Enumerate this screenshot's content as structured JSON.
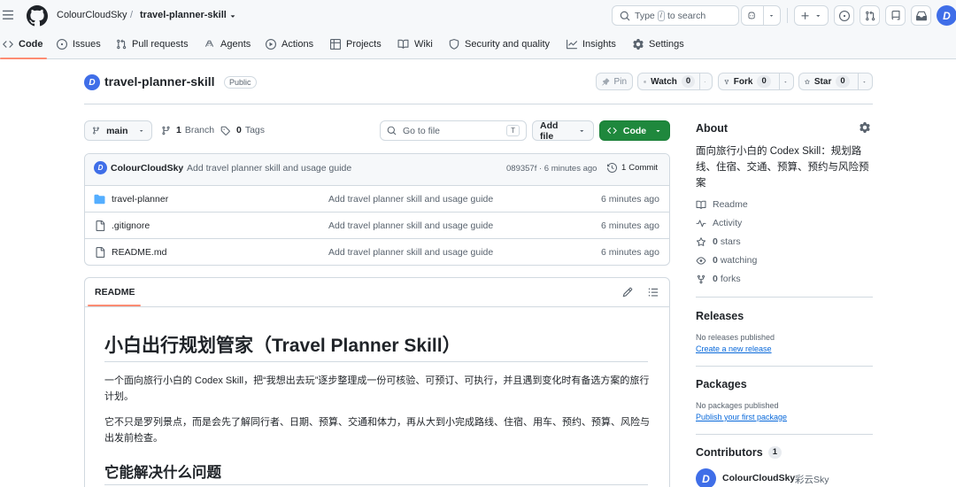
{
  "header": {
    "owner": "ColourCloudSky",
    "slash": "/",
    "repo": "travel-planner-skill",
    "search_prefix": "Type",
    "search_key": "/",
    "search_suffix": "to search",
    "avatar_letter": "D"
  },
  "tabs": [
    {
      "label": "Code",
      "icon": "code-icon"
    },
    {
      "label": "Issues",
      "icon": "issue-icon"
    },
    {
      "label": "Pull requests",
      "icon": "pull-request-icon"
    },
    {
      "label": "Agents",
      "icon": "agent-icon"
    },
    {
      "label": "Actions",
      "icon": "play-icon"
    },
    {
      "label": "Projects",
      "icon": "table-icon"
    },
    {
      "label": "Wiki",
      "icon": "book-icon"
    },
    {
      "label": "Security and quality",
      "icon": "shield-icon"
    },
    {
      "label": "Insights",
      "icon": "graph-icon"
    },
    {
      "label": "Settings",
      "icon": "gear-icon"
    }
  ],
  "repo_header": {
    "avatar_letter": "D",
    "name": "travel-planner-skill",
    "visibility": "Public",
    "pin_label": "Pin",
    "watch_label": "Watch",
    "watch_count": "0",
    "fork_label": "Fork",
    "fork_count": "0",
    "star_label": "Star",
    "star_count": "0"
  },
  "toolbar": {
    "branch": "main",
    "branch_count": "1",
    "branch_label": "Branch",
    "tag_count": "0",
    "tag_label": "Tags",
    "goto_placeholder": "Go to file",
    "goto_key": "T",
    "add_file": "Add file",
    "code_button": "Code"
  },
  "commit": {
    "author": "ColourCloudSky",
    "message": "Add travel planner skill and usage guide",
    "meta": "089357f · 6 minutes ago",
    "commits_count": "1",
    "commits_label": "Commit"
  },
  "files": [
    {
      "name": "travel-planner",
      "type": "folder",
      "message": "Add travel planner skill and usage guide",
      "time": "6 minutes ago"
    },
    {
      "name": ".gitignore",
      "type": "file",
      "message": "Add travel planner skill and usage guide",
      "time": "6 minutes ago"
    },
    {
      "name": "README.md",
      "type": "file",
      "message": "Add travel planner skill and usage guide",
      "time": "6 minutes ago"
    }
  ],
  "readme": {
    "tab_label": "README",
    "title": "小白出行规划管家（Travel Planner Skill）",
    "para1": "一个面向旅行小白的 Codex Skill，把“我想出去玩”逐步整理成一份可核验、可预订、可执行，并且遇到变化时有备选方案的旅行计划。",
    "para2": "它不只是罗列景点，而是会先了解同行者、日期、预算、交通和体力，再从大到小完成路线、住宿、用车、预约、预算、风险与出发前检查。",
    "h2": "它能解决什么问题"
  },
  "about": {
    "heading": "About",
    "description": "面向旅行小白的 Codex Skill：规划路线、住宿、交通、预算、预约与风险预案",
    "readme": "Readme",
    "activity": "Activity",
    "stars_count": "0",
    "stars_label": "stars",
    "watching_count": "0",
    "watching_label": "watching",
    "forks_count": "0",
    "forks_label": "forks"
  },
  "releases": {
    "heading": "Releases",
    "none": "No releases published",
    "link": "Create a new release"
  },
  "packages": {
    "heading": "Packages",
    "none": "No packages published",
    "link": "Publish your first package"
  },
  "contributors": {
    "heading": "Contributors",
    "count": "1",
    "avatar_letter": "D",
    "name": "ColourCloudSky",
    "alias": "彩云Sky"
  }
}
